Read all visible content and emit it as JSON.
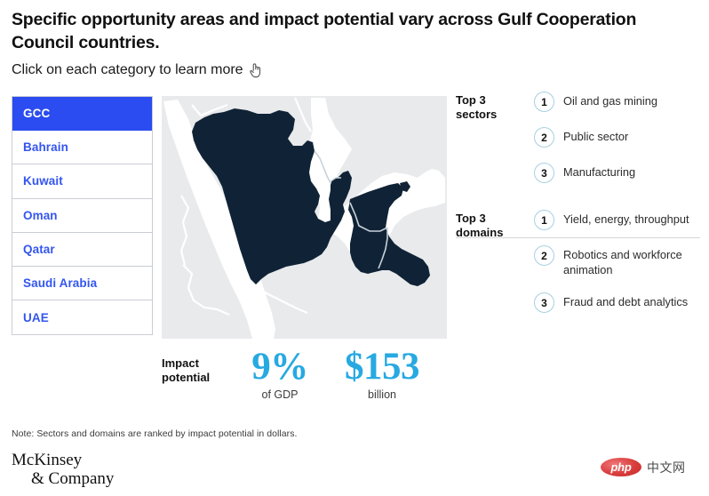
{
  "header": {
    "title": "Specific opportunity areas and impact potential vary across Gulf Cooperation Council countries.",
    "subtitle": "Click on each category to learn more",
    "cursor_icon": "pointing-hand-icon"
  },
  "sidebar": {
    "items": [
      {
        "label": "GCC",
        "selected": true
      },
      {
        "label": "Bahrain",
        "selected": false
      },
      {
        "label": "Kuwait",
        "selected": false
      },
      {
        "label": "Oman",
        "selected": false
      },
      {
        "label": "Qatar",
        "selected": false
      },
      {
        "label": "Saudi Arabia",
        "selected": false
      },
      {
        "label": "UAE",
        "selected": false
      }
    ],
    "selected_color": "#2a4cf0",
    "text_color": "#3355ef"
  },
  "map": {
    "region_name": "Arabian Peninsula - Gulf Cooperation Council",
    "highlight_color": "#102336",
    "sea_color": "#ffffff",
    "land_color": "#e9eaec",
    "border_color": "#ffffff"
  },
  "impact": {
    "label": "Impact\npotential",
    "label_line1": "Impact",
    "label_line2": "potential",
    "stats": [
      {
        "value": "9%",
        "caption": "of GDP"
      },
      {
        "value": "$153",
        "caption": "billion"
      }
    ],
    "value_color": "#27a9e1"
  },
  "groups": [
    {
      "label_line1": "Top 3",
      "label_line2": "sectors",
      "items": [
        {
          "rank": "1",
          "text": "Oil and gas mining"
        },
        {
          "rank": "2",
          "text": "Public sector"
        },
        {
          "rank": "3",
          "text": "Manufacturing"
        }
      ]
    },
    {
      "label_line1": "Top 3",
      "label_line2": "domains",
      "items": [
        {
          "rank": "1",
          "text": "Yield, energy, throughput"
        },
        {
          "rank": "2",
          "text": "Robotics and workforce animation"
        },
        {
          "rank": "3",
          "text": "Fraud and debt analytics"
        }
      ]
    }
  ],
  "footer": {
    "note": "Note: Sectors and domains are ranked by impact potential in dollars.",
    "logo_line1": "McKinsey",
    "logo_line2": "& Company"
  },
  "watermark": {
    "badge_text": "php",
    "text": "中文网"
  }
}
